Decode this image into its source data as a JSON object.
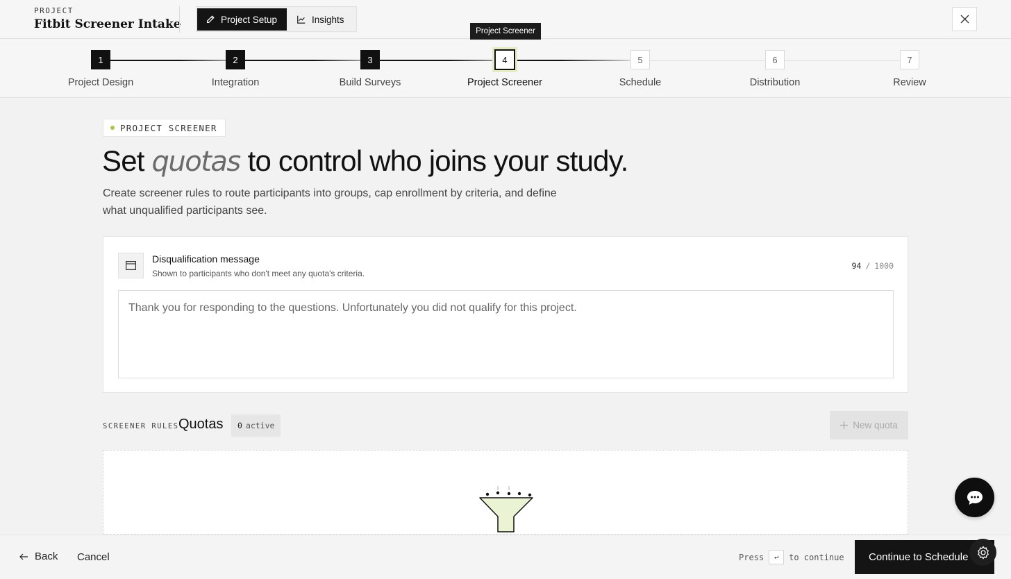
{
  "header": {
    "kicker": "PROJECT",
    "title": "Fitbit Screener Intake",
    "modes": [
      {
        "label": "Project Setup",
        "icon": "pencil-icon",
        "active": true
      },
      {
        "label": "Insights",
        "icon": "line-chart-icon",
        "active": false
      }
    ],
    "close_icon": "close-icon"
  },
  "stepper": {
    "tooltip": "Project Screener",
    "steps": [
      {
        "num": "1",
        "label": "Project Design",
        "state": "done"
      },
      {
        "num": "2",
        "label": "Integration",
        "state": "done"
      },
      {
        "num": "3",
        "label": "Build Surveys",
        "state": "done"
      },
      {
        "num": "4",
        "label": "Project Screener",
        "state": "current"
      },
      {
        "num": "5",
        "label": "Schedule",
        "state": "todo"
      },
      {
        "num": "6",
        "label": "Distribution",
        "state": "todo"
      },
      {
        "num": "7",
        "label": "Review",
        "state": "todo"
      }
    ]
  },
  "content": {
    "badge": "PROJECT SCREENER",
    "headline_pre": "Set ",
    "headline_em": "quotas",
    "headline_post": " to control who joins your study.",
    "subtext": "Create screener rules to route participants into groups, cap enrollment by criteria, and define what unqualified participants see."
  },
  "disqualification": {
    "title": "Disqualification message",
    "subtitle": "Shown to participants who don't meet any quota's criteria.",
    "count_current": "94",
    "count_sep": "/",
    "count_max": "1000",
    "message": "Thank you for responding to the questions. Unfortunately you did not qualify for this project."
  },
  "quotas": {
    "kicker": "SCREENER RULES",
    "title": "Quotas",
    "active_count": "0",
    "active_label": "active",
    "new_button": "New quota",
    "empty_icon": "funnel-icon"
  },
  "footer": {
    "back": "Back",
    "cancel": "Cancel",
    "press": "Press",
    "key": "↵",
    "to_continue": "to continue",
    "continue": "Continue to Schedule"
  },
  "floating": {
    "chat_icon": "chat-bubble-icon",
    "settings_icon": "gear-icon"
  }
}
